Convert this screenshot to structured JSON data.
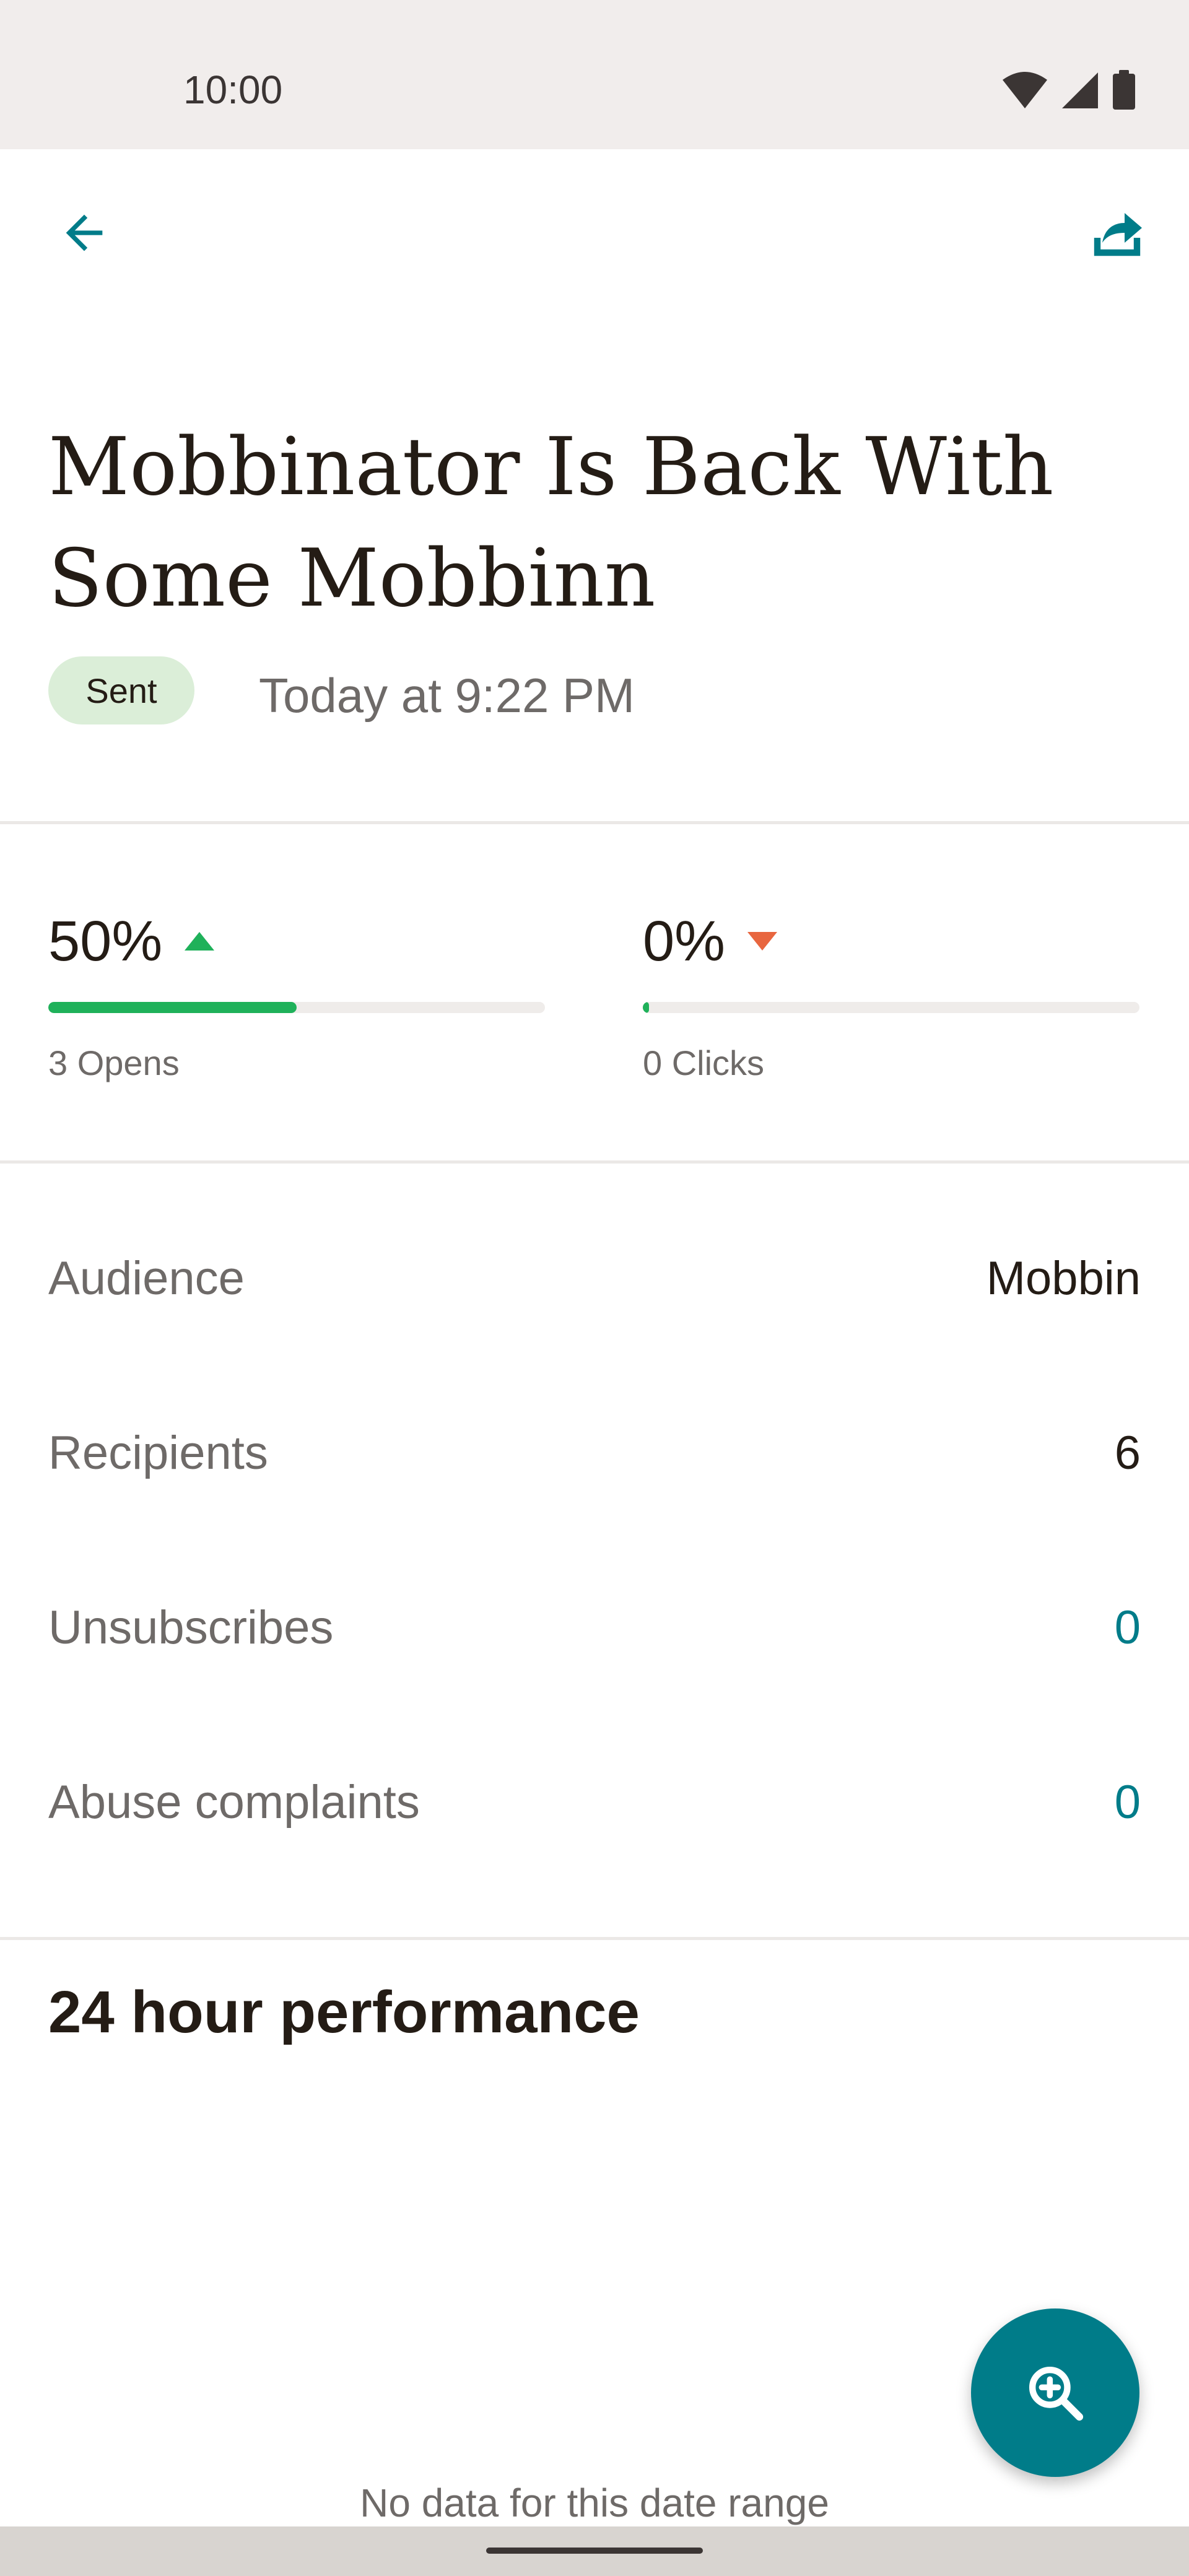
{
  "status_bar": {
    "time": "10:00"
  },
  "campaign": {
    "title": "Mobbinator Is Back With Some Mobbinn",
    "status": "Sent",
    "sent_time": "Today at 9:22 PM"
  },
  "stats": {
    "opens": {
      "percent": "50%",
      "label": "3 Opens",
      "trend": "up",
      "fraction": 0.5
    },
    "clicks": {
      "percent": "0%",
      "label": "0 Clicks",
      "trend": "down",
      "fraction": 0.0
    }
  },
  "details": [
    {
      "label": "Audience",
      "value": "Mobbin"
    },
    {
      "label": "Recipients",
      "value": "6"
    },
    {
      "label": "Unsubscribes",
      "value": "0"
    },
    {
      "label": "Abuse complaints",
      "value": "0"
    }
  ],
  "performance": {
    "title": "24 hour performance",
    "empty_text": "No data for this date range"
  },
  "colors": {
    "accent": "#007c89",
    "trend_up": "#1fb15a",
    "trend_down": "#e8663f",
    "badge_bg": "#dbeed8"
  },
  "icons": {
    "back": "arrow-left-icon",
    "share": "share-icon",
    "fab": "zoom-in-icon"
  }
}
